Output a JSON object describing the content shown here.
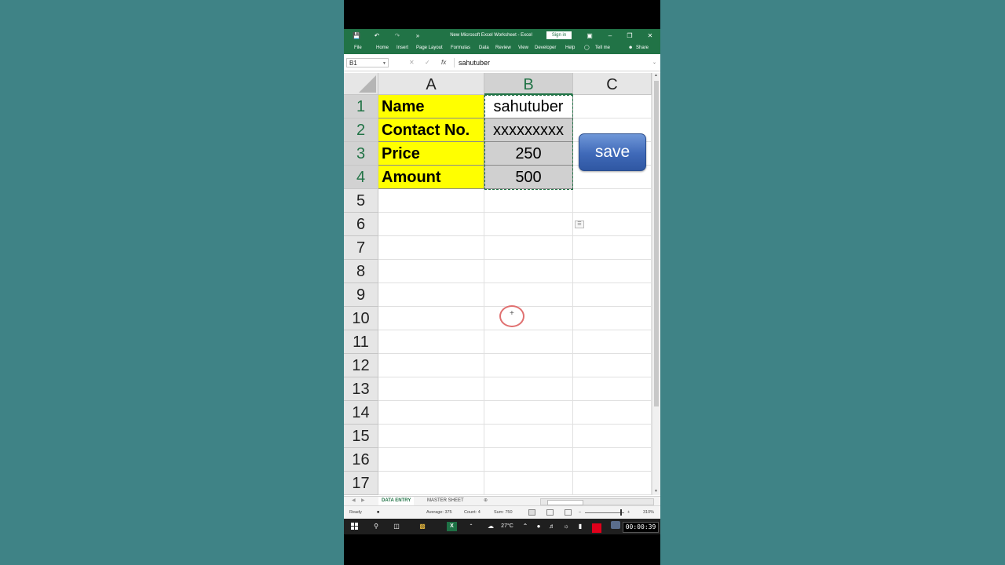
{
  "window": {
    "title": "New Microsoft Excel Worksheet  -  Excel",
    "sign_in": "Sign in"
  },
  "ribbon": {
    "tabs": [
      "File",
      "Home",
      "Insert",
      "Page Layout",
      "Formulas",
      "Data",
      "Review",
      "View",
      "Developer",
      "Help",
      "Tell me",
      "Share"
    ]
  },
  "formula_bar": {
    "name_box": "B1",
    "fx": "fx",
    "content": "sahutuber"
  },
  "sheet": {
    "columns": [
      "A",
      "B",
      "C"
    ],
    "selected_column": "B",
    "rows": [
      "1",
      "2",
      "3",
      "4",
      "5",
      "6",
      "7",
      "8",
      "9",
      "10",
      "11",
      "12",
      "13",
      "14",
      "15",
      "16",
      "17"
    ],
    "labels": [
      "Name",
      "Contact No.",
      "Price",
      "Amount"
    ],
    "values": [
      "sahutuber",
      "xxxxxxxxx",
      "250",
      "500"
    ],
    "label_fill": "#ffff00",
    "value_fill": "#d0d0d0",
    "save_button": "save"
  },
  "sheet_tabs": [
    "DATA ENTRY",
    "MASTER SHEET"
  ],
  "status": {
    "ready": "Ready",
    "average": "Average: 375",
    "count": "Count: 4",
    "sum": "Sum: 750",
    "zoom": "310%"
  },
  "taskbar": {
    "temperature": "27°C",
    "clock": "00:00:39"
  },
  "colors": {
    "excel_green": "#217346",
    "background": "#3f8386",
    "save_blue": "#3f69b8"
  }
}
